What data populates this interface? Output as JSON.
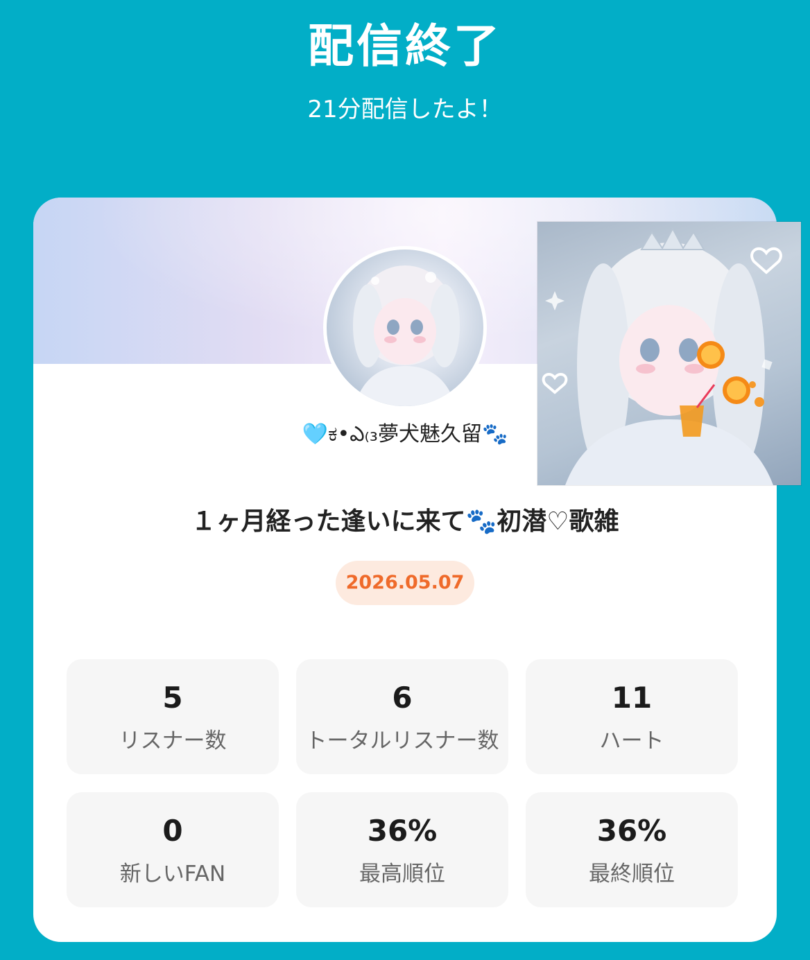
{
  "header": {
    "title": "配信終了",
    "subtitle": "21分配信したよ！"
  },
  "profile": {
    "name_heart": "🩵",
    "name_text": "ಕ•ఎ₍₃夢犬魅久留",
    "name_paw": "🐾"
  },
  "stream": {
    "title_part1": "１ヶ月経った逢いに来て",
    "title_paw": "🐾",
    "title_part2": "初潜♡歌雑",
    "date": "2026.05.07"
  },
  "stats": [
    {
      "value": "5",
      "label": "リスナー数"
    },
    {
      "value": "6",
      "label": "トータルリスナー数"
    },
    {
      "value": "11",
      "label": "ハート"
    },
    {
      "value": "0",
      "label": "新しいFAN"
    },
    {
      "value": "36%",
      "label": "最高順位"
    },
    {
      "value": "36%",
      "label": "最終順位"
    }
  ],
  "colors": {
    "background": "#02aec7",
    "card": "#ffffff",
    "date_badge_bg": "#fdeadf",
    "date_badge_text": "#ef6a2a",
    "stat_cell_bg": "#f6f6f6"
  }
}
